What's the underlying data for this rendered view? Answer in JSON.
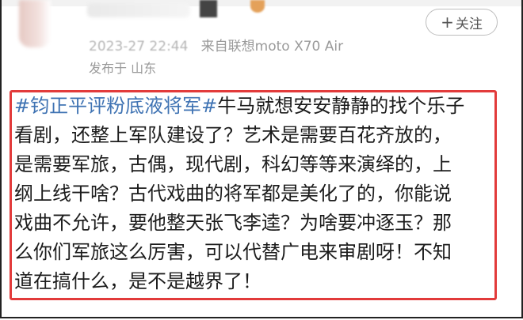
{
  "header": {
    "follow_plus": "+",
    "follow_label": "关注",
    "timestamp_partial": "2023-27 22:44",
    "source": "来自联想moto X70 Air",
    "location": "发布于 山东"
  },
  "post": {
    "line1_hashtag": "#钧正平评粉底液将军#",
    "line1_rest": "牛马就想安安静静的找个乐子",
    "line2": "看剧，还整上军队建设了？艺术是需要百花齐放的，",
    "line3": "是需要军旅，古偶，现代剧，科幻等等来演绎的，上",
    "line4": "纲上线干啥？古代戏曲的将军都是美化了的，你能说",
    "line5": "戏曲不允许，要他整天张飞李逵？为啥要冲逐玉？那",
    "line6": "么你们军旅这么厉害，可以代替广电来审剧呀！不知",
    "line7": "道在搞什么，是不是越界了！"
  },
  "colors": {
    "highlight_border": "#e23b3b",
    "hashtag": "#3f73b3",
    "meta_text": "#9a9a9a"
  }
}
